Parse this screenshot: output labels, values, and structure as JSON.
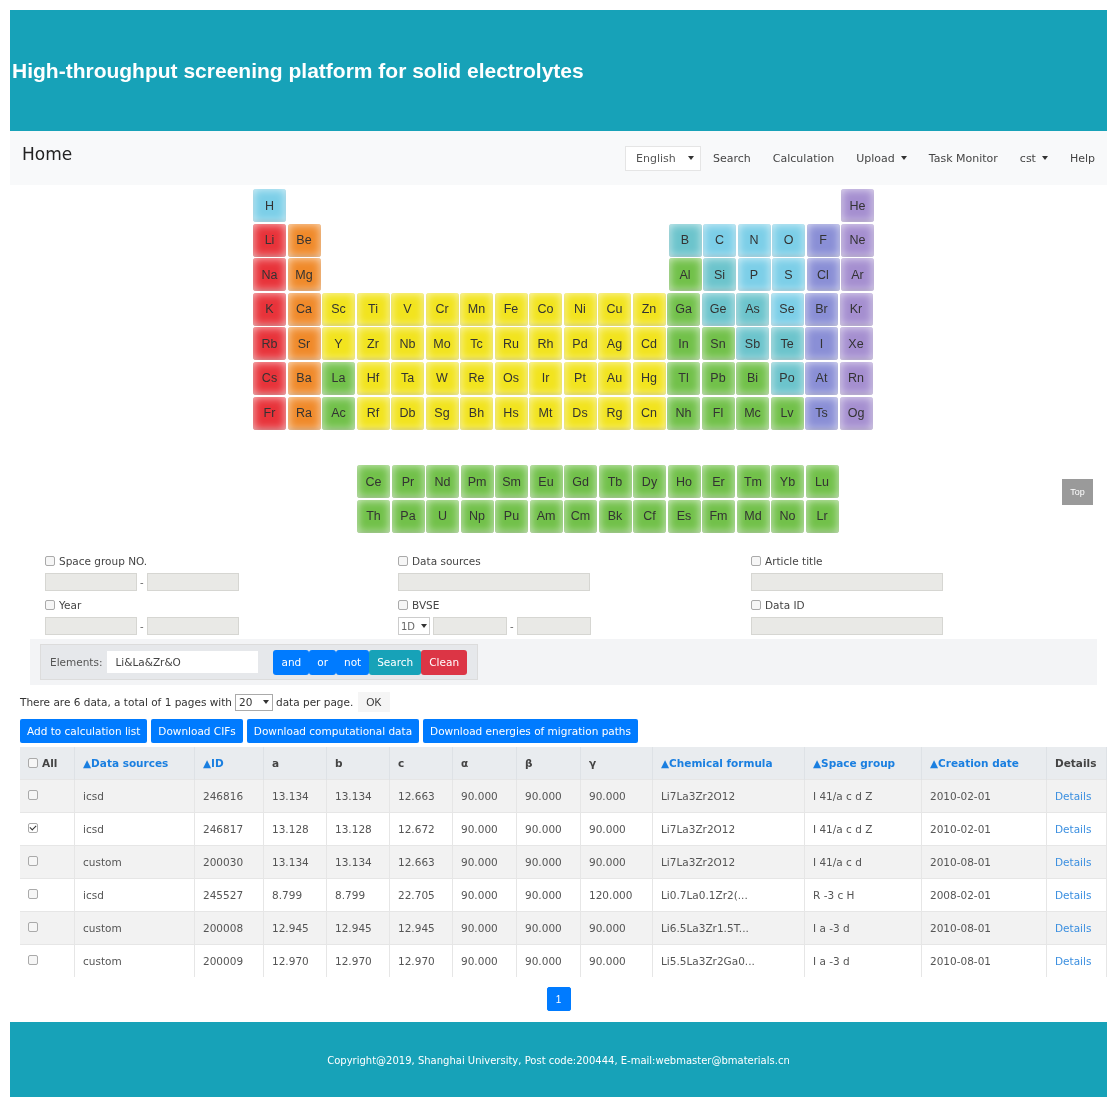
{
  "header": {
    "title": "High-throughput screening platform for solid electrolytes"
  },
  "navbar": {
    "brand": "Home",
    "language": "English",
    "items": [
      {
        "label": "Search",
        "dropdown": false
      },
      {
        "label": "Calculation",
        "dropdown": false
      },
      {
        "label": "Upload",
        "dropdown": true
      },
      {
        "label": "Task Monitor",
        "dropdown": false
      },
      {
        "label": "cst",
        "dropdown": true
      },
      {
        "label": "Help",
        "dropdown": false
      }
    ]
  },
  "periodic_table": {
    "rows": [
      {
        "left": [
          {
            "symbol": "H",
            "color": "#7ccfe8"
          }
        ],
        "right": [
          {
            "symbol": "He",
            "color": "#a58fd0"
          }
        ]
      },
      {
        "left": [
          {
            "symbol": "Li",
            "color": "#e8333a"
          },
          {
            "symbol": "Be",
            "color": "#f08a2a"
          }
        ],
        "right": [
          {
            "symbol": "B",
            "color": "#6cc4cc"
          },
          {
            "symbol": "C",
            "color": "#7ccfe8"
          },
          {
            "symbol": "N",
            "color": "#7ccfe8"
          },
          {
            "symbol": "O",
            "color": "#7ccfe8"
          },
          {
            "symbol": "F",
            "color": "#8a8fd6"
          },
          {
            "symbol": "Ne",
            "color": "#a58fd0"
          }
        ]
      },
      {
        "left": [
          {
            "symbol": "Na",
            "color": "#e8333a"
          },
          {
            "symbol": "Mg",
            "color": "#f08a2a"
          }
        ],
        "right": [
          {
            "symbol": "Al",
            "color": "#72c14a"
          },
          {
            "symbol": "Si",
            "color": "#6cc4cc"
          },
          {
            "symbol": "P",
            "color": "#7ccfe8"
          },
          {
            "symbol": "S",
            "color": "#7ccfe8"
          },
          {
            "symbol": "Cl",
            "color": "#8a8fd6"
          },
          {
            "symbol": "Ar",
            "color": "#a58fd0"
          }
        ]
      },
      {
        "left": [
          {
            "symbol": "K",
            "color": "#e8333a"
          },
          {
            "symbol": "Ca",
            "color": "#f08a2a"
          },
          {
            "symbol": "Sc",
            "color": "#f2e41e"
          },
          {
            "symbol": "Ti",
            "color": "#f2e41e"
          },
          {
            "symbol": "V",
            "color": "#f2e41e"
          },
          {
            "symbol": "Cr",
            "color": "#f2e41e"
          },
          {
            "symbol": "Mn",
            "color": "#f2e41e"
          },
          {
            "symbol": "Fe",
            "color": "#f2e41e"
          },
          {
            "symbol": "Co",
            "color": "#f2e41e"
          },
          {
            "symbol": "Ni",
            "color": "#f2e41e"
          },
          {
            "symbol": "Cu",
            "color": "#f2e41e"
          },
          {
            "symbol": "Zn",
            "color": "#f2e41e"
          },
          {
            "symbol": "Ga",
            "color": "#72c14a"
          },
          {
            "symbol": "Ge",
            "color": "#6cc4cc"
          },
          {
            "symbol": "As",
            "color": "#6cc4cc"
          },
          {
            "symbol": "Se",
            "color": "#7ccfe8"
          },
          {
            "symbol": "Br",
            "color": "#8a8fd6"
          },
          {
            "symbol": "Kr",
            "color": "#a58fd0"
          }
        ],
        "right": []
      },
      {
        "left": [
          {
            "symbol": "Rb",
            "color": "#e8333a"
          },
          {
            "symbol": "Sr",
            "color": "#f08a2a"
          },
          {
            "symbol": "Y",
            "color": "#f2e41e"
          },
          {
            "symbol": "Zr",
            "color": "#f2e41e"
          },
          {
            "symbol": "Nb",
            "color": "#f2e41e"
          },
          {
            "symbol": "Mo",
            "color": "#f2e41e"
          },
          {
            "symbol": "Tc",
            "color": "#f2e41e"
          },
          {
            "symbol": "Ru",
            "color": "#f2e41e"
          },
          {
            "symbol": "Rh",
            "color": "#f2e41e"
          },
          {
            "symbol": "Pd",
            "color": "#f2e41e"
          },
          {
            "symbol": "Ag",
            "color": "#f2e41e"
          },
          {
            "symbol": "Cd",
            "color": "#f2e41e"
          },
          {
            "symbol": "In",
            "color": "#72c14a"
          },
          {
            "symbol": "Sn",
            "color": "#72c14a"
          },
          {
            "symbol": "Sb",
            "color": "#6cc4cc"
          },
          {
            "symbol": "Te",
            "color": "#6cc4cc"
          },
          {
            "symbol": "I",
            "color": "#8a8fd6"
          },
          {
            "symbol": "Xe",
            "color": "#a58fd0"
          }
        ],
        "right": []
      },
      {
        "left": [
          {
            "symbol": "Cs",
            "color": "#e8333a"
          },
          {
            "symbol": "Ba",
            "color": "#f08a2a"
          },
          {
            "symbol": "La",
            "color": "#72c14a"
          },
          {
            "symbol": "Hf",
            "color": "#f2e41e"
          },
          {
            "symbol": "Ta",
            "color": "#f2e41e"
          },
          {
            "symbol": "W",
            "color": "#f2e41e"
          },
          {
            "symbol": "Re",
            "color": "#f2e41e"
          },
          {
            "symbol": "Os",
            "color": "#f2e41e"
          },
          {
            "symbol": "Ir",
            "color": "#f2e41e"
          },
          {
            "symbol": "Pt",
            "color": "#f2e41e"
          },
          {
            "symbol": "Au",
            "color": "#f2e41e"
          },
          {
            "symbol": "Hg",
            "color": "#f2e41e"
          },
          {
            "symbol": "Tl",
            "color": "#72c14a"
          },
          {
            "symbol": "Pb",
            "color": "#72c14a"
          },
          {
            "symbol": "Bi",
            "color": "#72c14a"
          },
          {
            "symbol": "Po",
            "color": "#6cc4cc"
          },
          {
            "symbol": "At",
            "color": "#8a8fd6"
          },
          {
            "symbol": "Rn",
            "color": "#a58fd0"
          }
        ],
        "right": []
      },
      {
        "left": [
          {
            "symbol": "Fr",
            "color": "#e8333a"
          },
          {
            "symbol": "Ra",
            "color": "#f08a2a"
          },
          {
            "symbol": "Ac",
            "color": "#72c14a"
          },
          {
            "symbol": "Rf",
            "color": "#f2e41e"
          },
          {
            "symbol": "Db",
            "color": "#f2e41e"
          },
          {
            "symbol": "Sg",
            "color": "#f2e41e"
          },
          {
            "symbol": "Bh",
            "color": "#f2e41e"
          },
          {
            "symbol": "Hs",
            "color": "#f2e41e"
          },
          {
            "symbol": "Mt",
            "color": "#f2e41e"
          },
          {
            "symbol": "Ds",
            "color": "#f2e41e"
          },
          {
            "symbol": "Rg",
            "color": "#f2e41e"
          },
          {
            "symbol": "Cn",
            "color": "#f2e41e"
          },
          {
            "symbol": "Nh",
            "color": "#72c14a"
          },
          {
            "symbol": "Fl",
            "color": "#72c14a"
          },
          {
            "symbol": "Mc",
            "color": "#72c14a"
          },
          {
            "symbol": "Lv",
            "color": "#72c14a"
          },
          {
            "symbol": "Ts",
            "color": "#8a8fd6"
          },
          {
            "symbol": "Og",
            "color": "#a58fd0"
          }
        ],
        "right": []
      }
    ],
    "series": [
      [
        {
          "symbol": "Ce",
          "color": "#72c14a"
        },
        {
          "symbol": "Pr",
          "color": "#72c14a"
        },
        {
          "symbol": "Nd",
          "color": "#72c14a"
        },
        {
          "symbol": "Pm",
          "color": "#72c14a"
        },
        {
          "symbol": "Sm",
          "color": "#72c14a"
        },
        {
          "symbol": "Eu",
          "color": "#72c14a"
        },
        {
          "symbol": "Gd",
          "color": "#72c14a"
        },
        {
          "symbol": "Tb",
          "color": "#72c14a"
        },
        {
          "symbol": "Dy",
          "color": "#72c14a"
        },
        {
          "symbol": "Ho",
          "color": "#72c14a"
        },
        {
          "symbol": "Er",
          "color": "#72c14a"
        },
        {
          "symbol": "Tm",
          "color": "#72c14a"
        },
        {
          "symbol": "Yb",
          "color": "#72c14a"
        },
        {
          "symbol": "Lu",
          "color": "#72c14a"
        }
      ],
      [
        {
          "symbol": "Th",
          "color": "#72c14a"
        },
        {
          "symbol": "Pa",
          "color": "#72c14a"
        },
        {
          "symbol": "U",
          "color": "#72c14a"
        },
        {
          "symbol": "Np",
          "color": "#72c14a"
        },
        {
          "symbol": "Pu",
          "color": "#72c14a"
        },
        {
          "symbol": "Am",
          "color": "#72c14a"
        },
        {
          "symbol": "Cm",
          "color": "#72c14a"
        },
        {
          "symbol": "Bk",
          "color": "#72c14a"
        },
        {
          "symbol": "Cf",
          "color": "#72c14a"
        },
        {
          "symbol": "Es",
          "color": "#72c14a"
        },
        {
          "symbol": "Fm",
          "color": "#72c14a"
        },
        {
          "symbol": "Md",
          "color": "#72c14a"
        },
        {
          "symbol": "No",
          "color": "#72c14a"
        },
        {
          "symbol": "Lr",
          "color": "#72c14a"
        }
      ]
    ]
  },
  "top_button": "Top",
  "filters": [
    {
      "label": "Space group NO.",
      "checked": false,
      "kind": "range"
    },
    {
      "label": "Data sources",
      "checked": false,
      "kind": "text"
    },
    {
      "label": "Article title",
      "checked": false,
      "kind": "text"
    },
    {
      "label": "Year",
      "checked": false,
      "kind": "range"
    },
    {
      "label": "BVSE",
      "checked": false,
      "kind": "dim_range",
      "select": "1D"
    },
    {
      "label": "Data ID",
      "checked": false,
      "kind": "text"
    }
  ],
  "range_separator": "-",
  "elements_search": {
    "label": "Elements:",
    "value": "Li&La&Zr&O",
    "buttons": [
      {
        "label": "and",
        "kind": "primary"
      },
      {
        "label": "or",
        "kind": "primary"
      },
      {
        "label": "not",
        "kind": "primary"
      },
      {
        "label": "Search",
        "kind": "info"
      },
      {
        "label": "Clean",
        "kind": "danger"
      }
    ]
  },
  "paging_info": {
    "before": "There are 6 data, a total of 1 pages with",
    "per_page": "20",
    "after": "data per page.",
    "ok": "OK"
  },
  "actions": [
    "Add to calculation list",
    "Download CIFs",
    "Download computational data",
    "Download energies of migration paths"
  ],
  "table": {
    "all_label": "All",
    "all_checked": false,
    "columns": [
      {
        "label": "▲Data sources",
        "sortable": true
      },
      {
        "label": "▲ID",
        "sortable": true
      },
      {
        "label": "a",
        "sortable": false
      },
      {
        "label": "b",
        "sortable": false
      },
      {
        "label": "c",
        "sortable": false
      },
      {
        "label": "α",
        "sortable": false
      },
      {
        "label": "β",
        "sortable": false
      },
      {
        "label": "γ",
        "sortable": false
      },
      {
        "label": "▲Chemical formula",
        "sortable": true
      },
      {
        "label": "▲Space group",
        "sortable": true
      },
      {
        "label": "▲Creation date",
        "sortable": true
      },
      {
        "label": "Details",
        "sortable": false
      }
    ],
    "rows": [
      {
        "checked": false,
        "cells": [
          "icsd",
          "246816",
          "13.134",
          "13.134",
          "12.663",
          "90.000",
          "90.000",
          "90.000",
          "Li7La3Zr2O12",
          "I 41/a c d Z",
          "2010-02-01"
        ],
        "link": "Details"
      },
      {
        "checked": true,
        "cells": [
          "icsd",
          "246817",
          "13.128",
          "13.128",
          "12.672",
          "90.000",
          "90.000",
          "90.000",
          "Li7La3Zr2O12",
          "I 41/a c d Z",
          "2010-02-01"
        ],
        "link": "Details"
      },
      {
        "checked": false,
        "cells": [
          "custom",
          "200030",
          "13.134",
          "13.134",
          "12.663",
          "90.000",
          "90.000",
          "90.000",
          "Li7La3Zr2O12",
          "I 41/a c d",
          "2010-08-01"
        ],
        "link": "Details"
      },
      {
        "checked": false,
        "cells": [
          "icsd",
          "245527",
          "8.799",
          "8.799",
          "22.705",
          "90.000",
          "90.000",
          "120.000",
          "Li0.7La0.1Zr2(...",
          "R -3 c H",
          "2008-02-01"
        ],
        "link": "Details"
      },
      {
        "checked": false,
        "cells": [
          "custom",
          "200008",
          "12.945",
          "12.945",
          "12.945",
          "90.000",
          "90.000",
          "90.000",
          "Li6.5La3Zr1.5T...",
          "I a -3 d",
          "2010-08-01"
        ],
        "link": "Details"
      },
      {
        "checked": false,
        "cells": [
          "custom",
          "200009",
          "12.970",
          "12.970",
          "12.970",
          "90.000",
          "90.000",
          "90.000",
          "Li5.5La3Zr2Ga0...",
          "I a -3 d",
          "2010-08-01"
        ],
        "link": "Details"
      }
    ]
  },
  "pagination": [
    {
      "label": "1",
      "selected": true
    }
  ],
  "footer": "Copyright@2019, Shanghai University, Post code:200444, E-mail:webmaster@bmaterials.cn"
}
